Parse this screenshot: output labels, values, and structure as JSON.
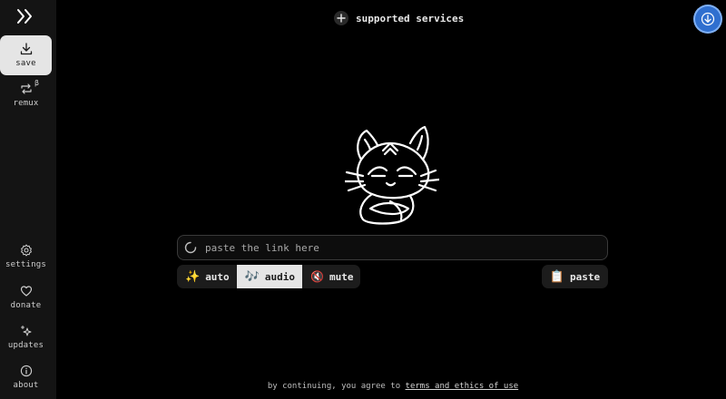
{
  "sidebar": {
    "items": [
      {
        "label": "save",
        "icon": "download-icon",
        "active": true
      },
      {
        "label": "remux",
        "icon": "remux-icon",
        "badge": "β"
      },
      {
        "label": "settings",
        "icon": "gear-icon"
      },
      {
        "label": "donate",
        "icon": "heart-icon"
      },
      {
        "label": "updates",
        "icon": "sparkle-icon"
      },
      {
        "label": "about",
        "icon": "info-icon"
      }
    ]
  },
  "header": {
    "supported_label": "supported services"
  },
  "input": {
    "placeholder": "paste the link here",
    "value": ""
  },
  "modes": [
    {
      "label": "auto",
      "icon": "sparkles-icon",
      "active": false
    },
    {
      "label": "audio",
      "icon": "music-notes-icon",
      "active": true
    },
    {
      "label": "mute",
      "icon": "muted-speaker-icon",
      "active": false
    }
  ],
  "paste": {
    "label": "paste",
    "icon": "clipboard-icon"
  },
  "footer": {
    "prefix": "by continuing, you agree to",
    "link": "terms and ethics of use"
  },
  "colors": {
    "background": "#000000",
    "sidebar": "#141414",
    "accent": "#2f6fcf",
    "active_bg": "#e5e5e5"
  }
}
